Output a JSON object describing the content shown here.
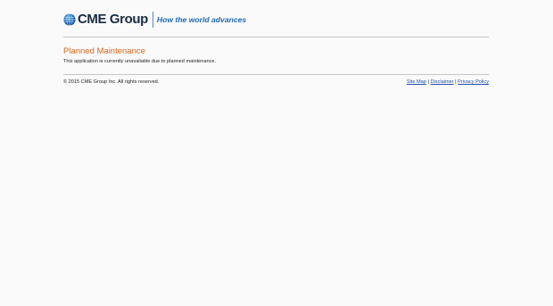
{
  "header": {
    "logo_text": "CME Group",
    "tagline": "How the world advances"
  },
  "notice": {
    "title": "Planned Maintenance",
    "message": "This application is currently unavailable due to planned maintenance."
  },
  "footer": {
    "copyright": "© 2015 CME Group Inc. All rights reserved.",
    "links": [
      {
        "label": "Site Map"
      },
      {
        "label": "Disclaimer"
      },
      {
        "label": "Privacy Policy"
      }
    ],
    "separator": "|"
  },
  "colors": {
    "brand_navy": "#1a2a44",
    "tagline_blue": "#1d68b5",
    "title_orange": "#d2691e",
    "link_blue": "#1d4fa8"
  },
  "icons": {
    "logo": "globe-icon"
  }
}
